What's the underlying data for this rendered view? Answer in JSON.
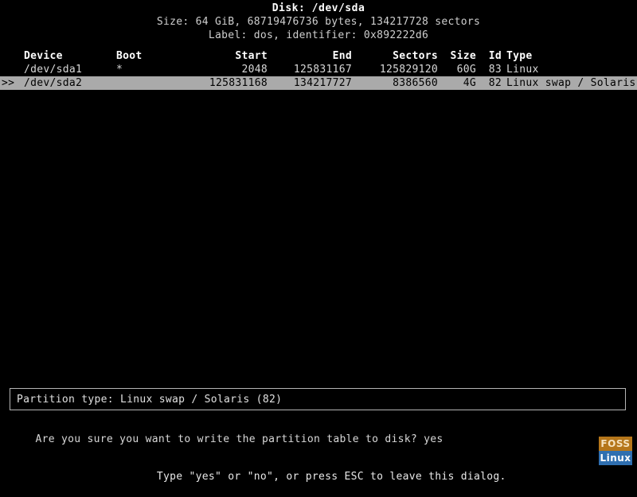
{
  "header": {
    "disk_title": "Disk: /dev/sda",
    "size_line": "Size: 64 GiB, 68719476736 bytes, 134217728 sectors",
    "label_line": "Label: dos, identifier: 0x892222d6"
  },
  "table": {
    "columns": {
      "marker": "",
      "device": "Device",
      "boot": "Boot",
      "start": "Start",
      "end": "End",
      "sectors": "Sectors",
      "size": "Size",
      "id": "Id",
      "type": "Type"
    },
    "rows": [
      {
        "marker": "",
        "device": "/dev/sda1",
        "boot": "*",
        "start": "2048",
        "end": "125831167",
        "sectors": "125829120",
        "size": "60G",
        "id": "83",
        "type": "Linux",
        "selected": false
      },
      {
        "marker": ">>",
        "device": "/dev/sda2",
        "boot": "",
        "start": "125831168",
        "end": "134217727",
        "sectors": "8386560",
        "size": "4G",
        "id": "82",
        "type": "Linux swap / Solaris",
        "selected": true
      }
    ]
  },
  "dialog": {
    "info_box_text": "Partition type: Linux swap / Solaris (82)",
    "prompt_text": "Are you sure you want to write the partition table to disk? yes",
    "prompt_answer": "yes",
    "hint_text": "Type \"yes\" or \"no\", or press ESC to leave this dialog."
  },
  "watermark": {
    "top_text": "FOSS",
    "bottom_text": "Linux"
  },
  "colors": {
    "background": "#000000",
    "foreground": "#d8d8d8",
    "selection_bg": "#aaaaaa",
    "selection_fg": "#000000",
    "box_border": "#b4b4b4",
    "watermark_top_bg": "#b5761a",
    "watermark_bottom_bg": "#2f6fb0"
  }
}
